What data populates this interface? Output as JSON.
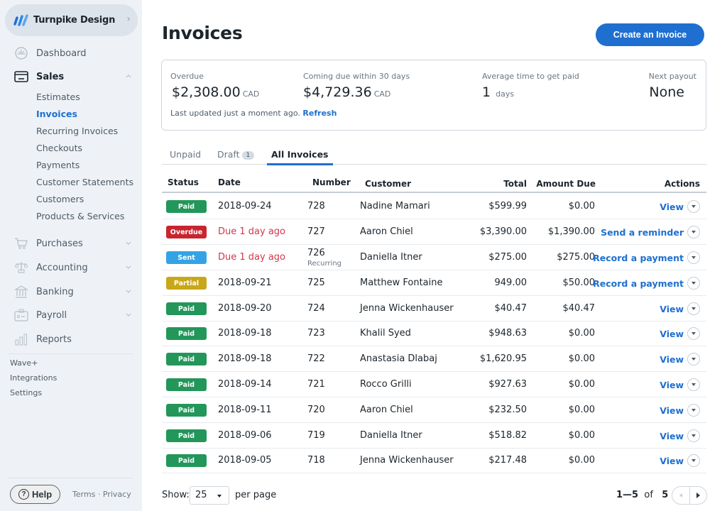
{
  "sidebar": {
    "business_name": "Turnpike Design",
    "main_items": [
      {
        "label": "Dashboard",
        "icon": "dashboard-icon"
      },
      {
        "label": "Sales",
        "icon": "card-icon",
        "expanded": true
      },
      {
        "label": "Purchases",
        "icon": "cart-icon"
      },
      {
        "label": "Accounting",
        "icon": "scale-icon"
      },
      {
        "label": "Banking",
        "icon": "bank-icon"
      },
      {
        "label": "Payroll",
        "icon": "badge-icon"
      },
      {
        "label": "Reports",
        "icon": "bar-chart-icon"
      }
    ],
    "sales_subitems": [
      "Estimates",
      "Invoices",
      "Recurring Invoices",
      "Checkouts",
      "Payments",
      "Customer Statements",
      "Customers",
      "Products & Services"
    ],
    "active_subitem": "Invoices",
    "secondary": [
      "Wave+",
      "Integrations",
      "Settings"
    ],
    "help_label": "Help",
    "help_icon": "?",
    "terms_label": "Terms",
    "separator": "·",
    "privacy_label": "Privacy"
  },
  "header": {
    "title": "Invoices",
    "create_button": "Create an Invoice"
  },
  "summary": {
    "overdue": {
      "label": "Overdue",
      "value": "$2,308.00",
      "unit": "CAD"
    },
    "coming_due": {
      "label": "Coming due within 30 days",
      "value": "$4,729.36",
      "unit": "CAD"
    },
    "avg_time": {
      "label": "Average time to get paid",
      "value": "1",
      "unit": "days"
    },
    "next_payout": {
      "label": "Next payout",
      "value": "None"
    },
    "last_updated": "Last updated just a moment ago.",
    "refresh_label": "Refresh"
  },
  "tabs": [
    {
      "label": "Unpaid"
    },
    {
      "label": "Draft",
      "count": "1"
    },
    {
      "label": "All Invoices",
      "active": true
    }
  ],
  "table": {
    "columns": [
      "Status",
      "Date",
      "Number",
      "Customer",
      "Total",
      "Amount Due",
      "Actions"
    ],
    "rows": [
      {
        "status": "Paid",
        "date": "2018-09-24",
        "number": "728",
        "customer": "Nadine Mamari",
        "total": "$599.99",
        "amount_due": "$0.00",
        "action": "View"
      },
      {
        "status": "Overdue",
        "date": "Due 1 day ago",
        "number": "727",
        "customer": "Aaron Chiel",
        "total": "$3,390.00",
        "amount_due": "$1,390.00",
        "action": "Send a reminder"
      },
      {
        "status": "Sent",
        "date": "Due 1 day ago",
        "number": "726",
        "number_sub": "Recurring",
        "customer": "Daniella Itner",
        "total": "$275.00",
        "amount_due": "$275.00",
        "action": "Record a payment"
      },
      {
        "status": "Partial",
        "date": "2018-09-21",
        "number": "725",
        "customer": "Matthew Fontaine",
        "total": "949.00",
        "amount_due": "$50.00",
        "action": "Record a payment"
      },
      {
        "status": "Paid",
        "date": "2018-09-20",
        "number": "724",
        "customer": "Jenna Wickenhauser",
        "total": "$40.47",
        "amount_due": "$40.47",
        "action": "View"
      },
      {
        "status": "Paid",
        "date": "2018-09-18",
        "number": "723",
        "customer": "Khalil Syed",
        "total": "$948.63",
        "amount_due": "$0.00",
        "action": "View"
      },
      {
        "status": "Paid",
        "date": "2018-09-18",
        "number": "722",
        "customer": "Anastasia Dlabaj",
        "total": "$1,620.95",
        "amount_due": "$0.00",
        "action": "View"
      },
      {
        "status": "Paid",
        "date": "2018-09-14",
        "number": "721",
        "customer": "Rocco Grilli",
        "total": "$927.63",
        "amount_due": "$0.00",
        "action": "View"
      },
      {
        "status": "Paid",
        "date": "2018-09-11",
        "number": "720",
        "customer": "Aaron Chiel",
        "total": "$232.50",
        "amount_due": "$0.00",
        "action": "View"
      },
      {
        "status": "Paid",
        "date": "2018-09-06",
        "number": "719",
        "customer": "Daniella Itner",
        "total": "$518.82",
        "amount_due": "$0.00",
        "action": "View"
      },
      {
        "status": "Paid",
        "date": "2018-09-05",
        "number": "718",
        "customer": "Jenna Wickenhauser",
        "total": "$217.48",
        "amount_due": "$0.00",
        "action": "View"
      }
    ]
  },
  "status_colors": {
    "Paid": "#23965a",
    "Overdue": "#c8252f",
    "Sent": "#34a3e6",
    "Partial": "#c9a718"
  },
  "colors": {
    "accent": "#1e6fd0",
    "due_text": "#d0374a"
  },
  "footer": {
    "show_label": "Show:",
    "per_page_value": "25",
    "per_page_label": "per page",
    "range": "1—5",
    "of_label": "of",
    "total_pages": "5"
  }
}
